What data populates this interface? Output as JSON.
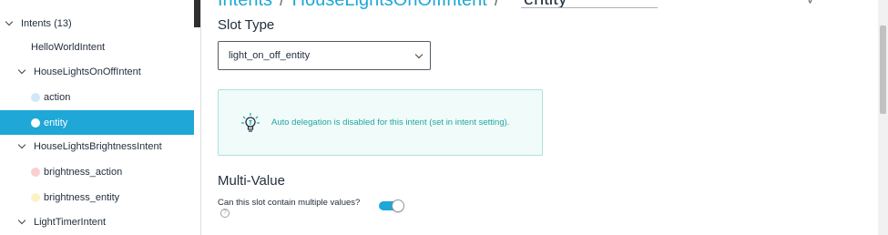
{
  "sidebar": {
    "items": [
      {
        "label": "Intents (13)",
        "kind": "group"
      },
      {
        "label": "HelloWorldIntent",
        "kind": "intent"
      },
      {
        "label": "HouseLightsOnOffIntent",
        "kind": "group"
      },
      {
        "label": "action",
        "kind": "slot",
        "dot_color": "#cfe8f7"
      },
      {
        "label": "entity",
        "kind": "slot",
        "dot_color": "#ffffff",
        "selected": true
      },
      {
        "label": "HouseLightsBrightnessIntent",
        "kind": "group"
      },
      {
        "label": "brightness_action",
        "kind": "slot",
        "dot_color": "#f8d0d0"
      },
      {
        "label": "brightness_entity",
        "kind": "slot",
        "dot_color": "#fbf3c6"
      },
      {
        "label": "LightTimerIntent",
        "kind": "group"
      }
    ]
  },
  "breadcrumb": {
    "root": "Intents",
    "sep": "/",
    "intent": "HouseLightsOnOffIntent",
    "slot_value": "entity"
  },
  "slot_type": {
    "title": "Slot Type",
    "selected": "light_on_off_entity"
  },
  "info": {
    "text_before": "Auto delegation is disabled for this intent (set in ",
    "link": "intent setting",
    "text_after": ")."
  },
  "multi_value": {
    "title": "Multi-Value",
    "question": "Can this slot contain multiple values?",
    "help": "?",
    "toggle_on": true
  },
  "colors": {
    "accent": "#1ea7d7",
    "info_text": "#1ea7a0",
    "info_bg": "#f1fbfa"
  }
}
